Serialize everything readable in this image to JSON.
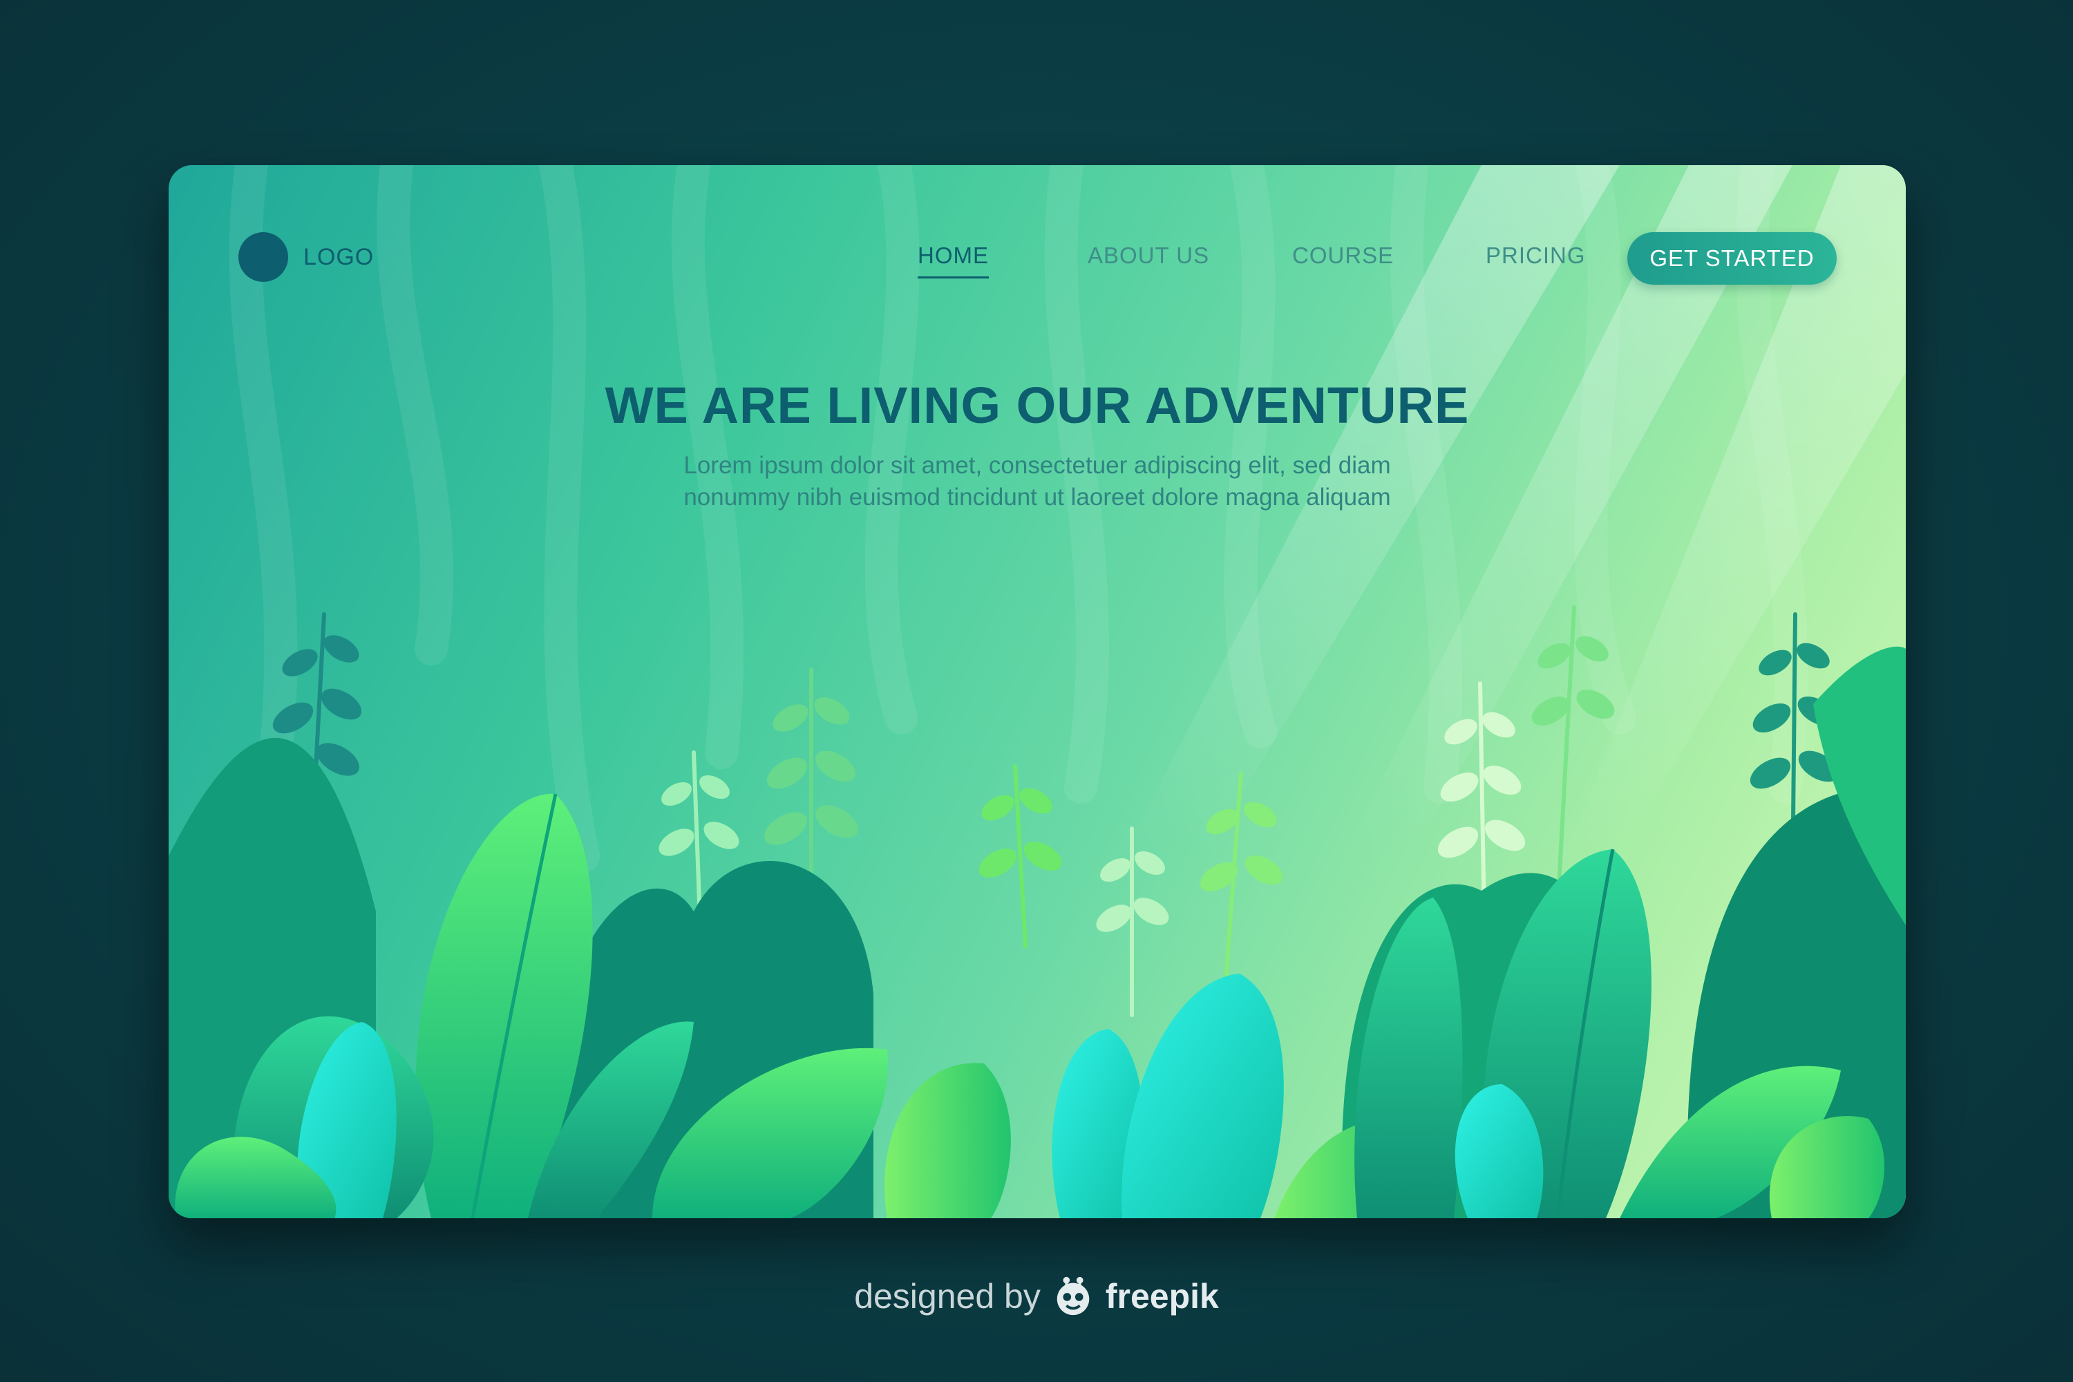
{
  "logo": {
    "text": "LOGO"
  },
  "nav": {
    "items": [
      {
        "label": "HOME",
        "active": true
      },
      {
        "label": "ABOUT US",
        "active": false
      },
      {
        "label": "COURSE",
        "active": false
      },
      {
        "label": "PRICING",
        "active": false
      }
    ],
    "cta_label": "GET STARTED"
  },
  "hero": {
    "title": "WE ARE LIVING OUR ADVENTURE",
    "subtitle_line1": "Lorem ipsum dolor sit amet, consectetuer adipiscing elit, sed diam",
    "subtitle_line2": "nonummy nibh euismod tincidunt ut laoreet dolore magna aliquam"
  },
  "credit": {
    "prefix": "designed by",
    "brand": "freepik"
  },
  "colors": {
    "page_background": "#0b3e45",
    "brand_dark": "#0d5e6e",
    "nav_text": "#3f8e89",
    "cta_background": "#1f9c8e",
    "cta_text": "#ffffff"
  },
  "icons": {
    "logo": "circle-logo-icon",
    "credit": "freepik-mascot-icon"
  }
}
